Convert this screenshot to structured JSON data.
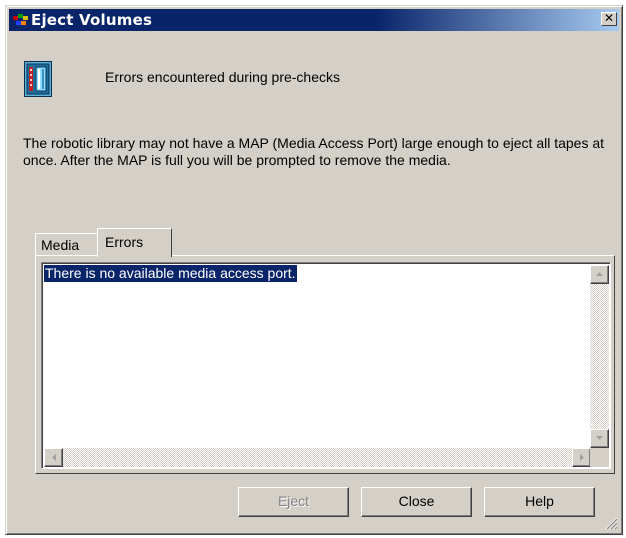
{
  "window": {
    "title": "Eject Volumes",
    "close_glyph": "✕"
  },
  "header": {
    "icon": "tape-library-icon",
    "message": "Errors encountered during pre-checks"
  },
  "description": "The robotic library may not have a MAP (Media Access Port) large enough to eject all tapes at once.  After the MAP is full you will be prompted to remove the media.",
  "tabs": [
    {
      "label": "Media",
      "active": false
    },
    {
      "label": "Errors",
      "active": true
    }
  ],
  "errors_list": {
    "items": [
      "There is no available media access port."
    ],
    "selected_index": 0
  },
  "buttons": {
    "eject": {
      "label": "Eject",
      "enabled": false
    },
    "close": {
      "label": "Close",
      "enabled": true
    },
    "help": {
      "label": "Help",
      "enabled": true
    }
  },
  "colors": {
    "titlebar_start": "#0a246a",
    "titlebar_end": "#a6caf0",
    "dialog_face": "#d4d0c8",
    "selection": "#0a246a"
  }
}
